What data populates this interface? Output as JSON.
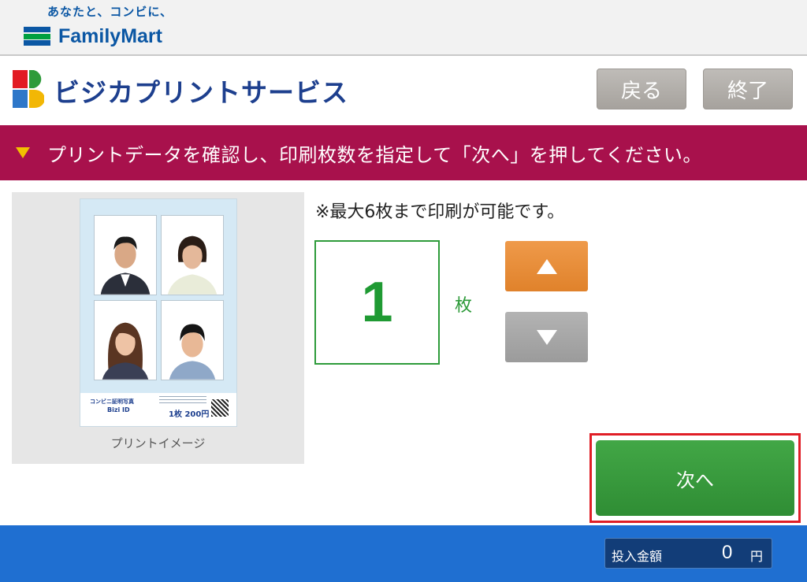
{
  "brand": {
    "tagline": "あなたと、コンビに、",
    "name": "FamilyMart",
    "colors": {
      "blue": "#0b57a4",
      "green": "#00a040"
    }
  },
  "header": {
    "service_title": "ビジカプリントサービス",
    "back_label": "戻る",
    "end_label": "終了"
  },
  "banner": {
    "instruction": "プリントデータを確認し、印刷枚数を指定して「次へ」を押してください。",
    "color": "#a8114c"
  },
  "preview": {
    "label": "プリントイメージ",
    "sheet_brand": "コンビニ証明写真",
    "sheet_id": "Bizi ID",
    "sheet_price": "1枚 200円"
  },
  "quantity": {
    "max_note": "※最大6枚まで印刷が可能です。",
    "value": "1",
    "unit": "枚",
    "up_icon": "triangle-up-icon",
    "down_icon": "triangle-down-icon"
  },
  "actions": {
    "next_label": "次へ"
  },
  "footer": {
    "money_label": "投入金額",
    "money_value": "0",
    "money_unit": "円"
  }
}
